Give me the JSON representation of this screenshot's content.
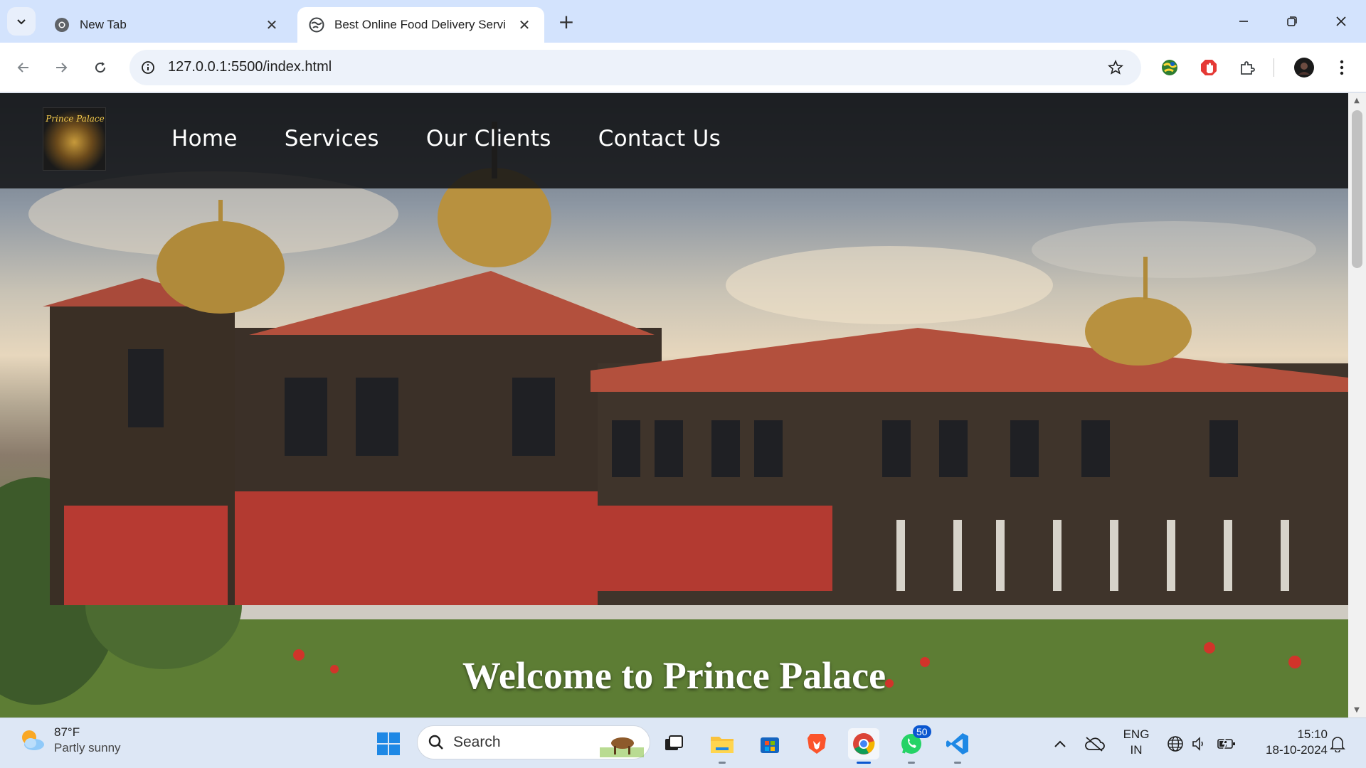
{
  "browser": {
    "tabs": [
      {
        "title": "New Tab",
        "active": false
      },
      {
        "title": "Best Online Food Delivery Servi",
        "active": true
      }
    ],
    "address": "127.0.0.1:5500/index.html"
  },
  "site": {
    "logo_text": "Prince Palace",
    "nav": [
      "Home",
      "Services",
      "Our Clients",
      "Contact Us"
    ],
    "hero_heading": "Welcome to Prince Palace"
  },
  "taskbar": {
    "weather": {
      "temp": "87°F",
      "condition": "Partly sunny"
    },
    "search_label": "Search",
    "whatsapp_badge": "50",
    "language": {
      "line1": "ENG",
      "line2": "IN"
    },
    "time": "15:10",
    "date": "18-10-2024"
  },
  "colors": {
    "tabstrip": "#d3e3fd",
    "header_overlay": "#141618",
    "accent": "#0b57d0"
  }
}
